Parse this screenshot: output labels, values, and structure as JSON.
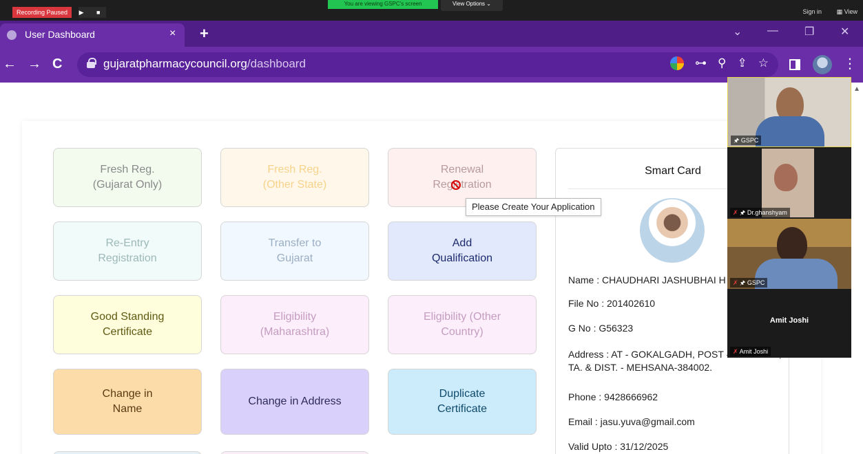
{
  "zoom": {
    "recording_label": "Recording Paused",
    "recording_controls": "▶ ■",
    "viewing_banner": "You are viewing GSPC's screen",
    "view_options": "View Options ⌄",
    "sign_in": "Sign in",
    "view": "▦ View"
  },
  "browser": {
    "tab_title": "User Dashboard",
    "tab_close": "×",
    "new_tab": "+",
    "window_controls": [
      "⌄",
      "—",
      "❐",
      "✕"
    ],
    "nav": [
      "←",
      "→",
      "C"
    ],
    "url_domain": "gujaratpharmacycouncil.org",
    "url_path": "/dashboard",
    "omni_icons": [
      "⊶",
      "⚲",
      "⇪",
      "☆"
    ],
    "kebab": "⋮"
  },
  "colors": {
    "chrome_dark": "#4f1f87",
    "chrome_tab": "#6a2fa8"
  },
  "cards": [
    {
      "label": "Fresh Reg.\n(Gujarat Only)",
      "bg": "#f3fbee",
      "color": "#8a8a8a"
    },
    {
      "label": "Fresh Reg.\n(Other State)",
      "bg": "#fff7ea",
      "color": "#f7d38a"
    },
    {
      "label": "Renewal\nRegistration",
      "bg": "#fff0f0",
      "color": "#b79a9a"
    },
    {
      "label": "Re-Entry\nRegistration",
      "bg": "#f1fbfa",
      "color": "#9cb9b7"
    },
    {
      "label": "Transfer to\nGujarat",
      "bg": "#f2f8ff",
      "color": "#9aaec4"
    },
    {
      "label": "Add\nQualification",
      "bg": "#e3e9fd",
      "color": "#1b2a6e"
    },
    {
      "label": "Good Standing\nCertificate",
      "bg": "#fffedc",
      "color": "#5f5a12"
    },
    {
      "label": "Eligibility\n(Maharashtra)",
      "bg": "#fdeefb",
      "color": "#c49cc0"
    },
    {
      "label": "Eligibility (Other\nCountry)",
      "bg": "#fdeefb",
      "color": "#c49cc0"
    },
    {
      "label": "Change in\nName",
      "bg": "#fcdca8",
      "color": "#5a3a12"
    },
    {
      "label": "Change in Address",
      "bg": "#d9d1fb",
      "color": "#2e2a5a"
    },
    {
      "label": "Duplicate\nCertificate",
      "bg": "#ccebfb",
      "color": "#0f4a6a"
    }
  ],
  "tooltip": "Please Create Your Application",
  "smart_card": {
    "title": "Smart Card",
    "name": "Name : CHAUDHARI JASHUBHAI H",
    "file_no": "File No : 201402610",
    "g_no": "G No : G56323",
    "address": "Address : AT - GOKALGADH, POST - SAMETRA, TA. & DIST. - MEHSANA-384002.",
    "phone": "Phone : 9428666962",
    "email": "Email : jasu.yuva@gmail.com",
    "valid_upto": "Valid Upto : 31/12/2025"
  },
  "participants": [
    {
      "label": "GSPC"
    },
    {
      "label": "Dr.ghanshyam"
    },
    {
      "label": "GSPC"
    },
    {
      "label": "Amit Joshi",
      "display_name": "Amit Joshi"
    }
  ]
}
